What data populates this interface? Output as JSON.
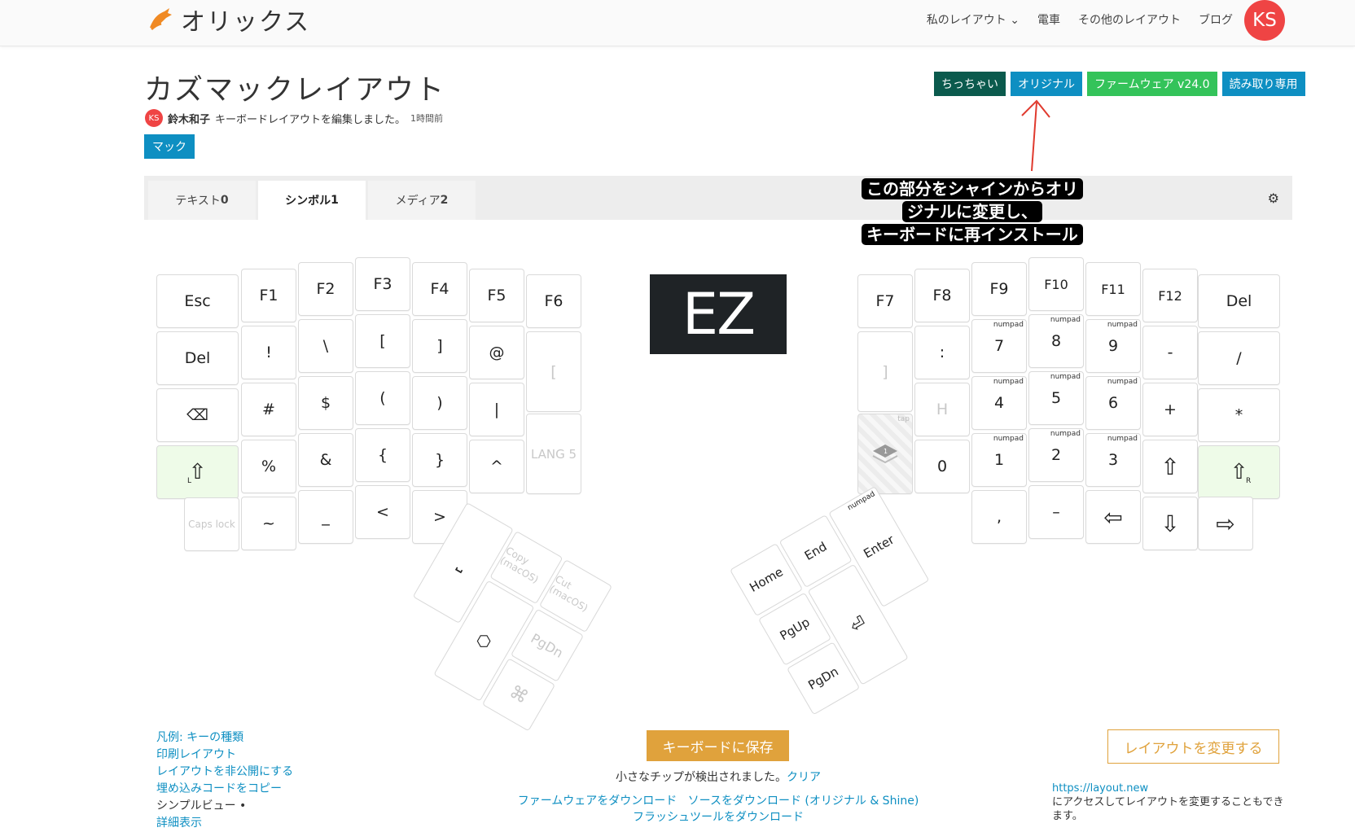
{
  "header": {
    "logo_text": "オリックス",
    "nav": [
      "私のレイアウト",
      "電車",
      "その他のレイアウト",
      "ブログ"
    ],
    "avatar": "KS"
  },
  "layout": {
    "title": "カズマックレイアウト",
    "avatar": "KS",
    "author": "鈴木和子",
    "action": "キーボードレイアウトを編集しました。",
    "time": "1時間前",
    "tag": "マック"
  },
  "badges": [
    {
      "label": "ちっちゃい",
      "color": "#0b5a4d"
    },
    {
      "label": "オリジナル",
      "color": "#0e8fc2"
    },
    {
      "label": "ファームウェア v24.0",
      "color": "#34c35a"
    },
    {
      "label": "読み取り専用",
      "color": "#0e8fc2"
    }
  ],
  "tabs": [
    {
      "label": "テキスト",
      "num": "0"
    },
    {
      "label": "シンボル",
      "num": "1"
    },
    {
      "label": "メディア",
      "num": "2"
    }
  ],
  "callout": {
    "line1": "この部分をシャインからオリ",
    "line2": "ジナルに変更し、",
    "line3": "キーボードに再インストール"
  },
  "ez": "EZ",
  "left_keys": {
    "row1": [
      "Esc",
      "F1",
      "F2",
      "F3",
      "F4",
      "F5",
      "F6"
    ],
    "row2": [
      "Del",
      "!",
      "\\",
      "[",
      "]",
      "@",
      "["
    ],
    "row3": [
      "⌫",
      "#",
      "$",
      "(",
      ")",
      "|",
      "LANG 5"
    ],
    "row4": [
      "⇧",
      "%",
      "&",
      "{",
      "}",
      "^"
    ],
    "row5": [
      "Caps lock",
      "~",
      "_",
      "<",
      ">"
    ],
    "shift_sub": "L"
  },
  "right_keys": {
    "row1": [
      "F7",
      "F8",
      "F9",
      "F10",
      "F11",
      "F12",
      "Del"
    ],
    "row2": [
      "]",
      ":",
      "7",
      "8",
      "9",
      "-",
      "/"
    ],
    "row3": [
      "H",
      "4",
      "5",
      "6",
      "+",
      "*"
    ],
    "row4": [
      "0",
      "1",
      "2",
      "3",
      "⇧",
      "⇧"
    ],
    "row5": [
      ",",
      "–",
      "⇦",
      "⇩",
      "⇨"
    ],
    "numpad": "numpad",
    "tap": "tap",
    "shift_sub": "R"
  },
  "thumb_left": {
    "keys": [
      "Copy (macOS)",
      "Cut (macOS)",
      "PgDn"
    ]
  },
  "thumb_right": {
    "keys": [
      "Home",
      "End",
      "numpad",
      "Enter",
      "PgUp",
      "PgDn"
    ]
  },
  "footer": {
    "links": [
      "凡例: キーの種類",
      "印刷レイアウト",
      "レイアウトを非公開にする",
      "埋め込みコードをコピー"
    ],
    "simple_view": "シンプルビュー •",
    "detail": "詳細表示",
    "save": "キーボードに保存",
    "chip_msg": "小さなチップが検出されました。",
    "clear": "クリア",
    "dl_firmware": "ファームウェアをダウンロード",
    "dl_source": "ソースをダウンロード (オリジナル & Shine)",
    "dl_flash": "フラッシュツールをダウンロード",
    "change": "レイアウトを変更する",
    "note_url": "https://layout.new",
    "note_text": "にアクセスしてレイアウトを変更することもできます。"
  },
  "colors": {
    "accent": "#0e8fc2",
    "orange": "#e0a23c",
    "avatar": "#ef4444",
    "green_key": "#eefbe8"
  }
}
